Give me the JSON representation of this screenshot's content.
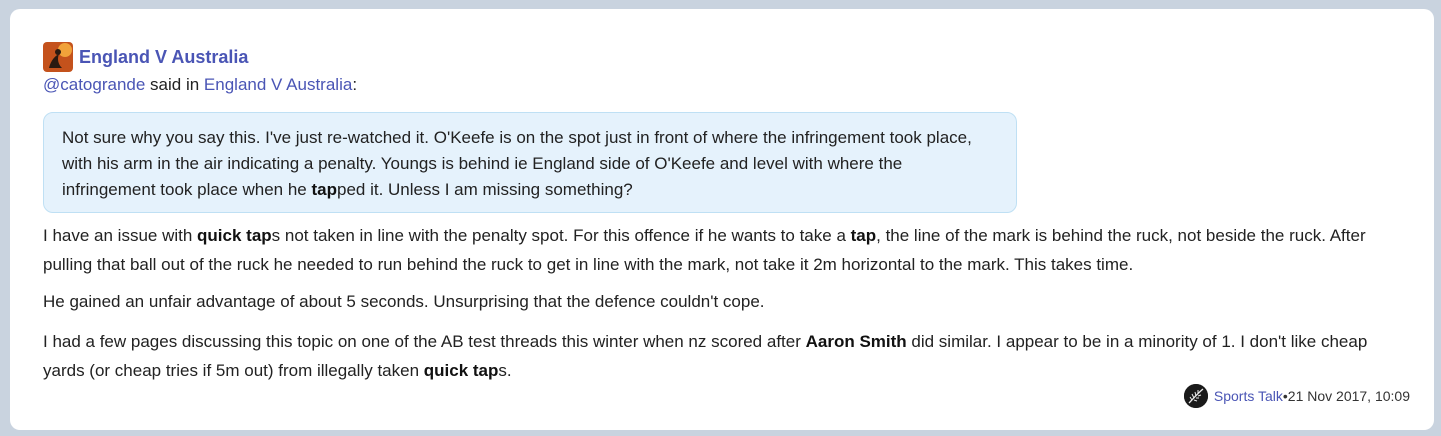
{
  "post": {
    "title": "England V Australia",
    "said": {
      "user": "@catogrande",
      "middle": " said in ",
      "topic": "England V Australia",
      "end": ":"
    },
    "quote": {
      "before": "Not sure why you say this. I've just re-watched it. O'Keefe is on the spot just in front of where the infringement took place, with his arm in the air indicating a penalty. Youngs is behind ie England side of O'Keefe and level with where the infringement took place when he ",
      "bold": "tap",
      "after": "ped it. Unless I am missing something?"
    },
    "p1": {
      "a": "I have an issue with ",
      "b1": "quick tap",
      "c": "s not taken in line with the penalty spot. For this offence if he wants to take a ",
      "b2": "tap",
      "d": ", the line of the mark is behind the ruck, not beside the ruck. After pulling that ball out of the ruck he needed to run behind the ruck to get in line with the mark, not take it 2m horizontal to the mark. This takes time."
    },
    "p2": "He gained an unfair advantage of about 5 seconds. Unsurprising that the defence couldn't cope.",
    "p3": {
      "a": "I had a few pages discussing this topic on one of the AB test threads this winter when nz scored after ",
      "b1": "Aaron Smith",
      "c": " did similar. I appear to be in a minority of 1. I don't like cheap yards (or cheap tries if 5m out) from illegally taken ",
      "b2": "quick tap",
      "d": "s."
    },
    "footer": {
      "category": "Sports Talk",
      "separator": " • ",
      "timestamp": "21 Nov 2017, 10:09"
    }
  },
  "icons": {
    "avatar": "topic-avatar-icon",
    "category": "silver-fern-icon"
  },
  "colors": {
    "link": "#4a55b5",
    "quote_bg": "#e5f2fc",
    "page_bg": "#c9d3df"
  }
}
